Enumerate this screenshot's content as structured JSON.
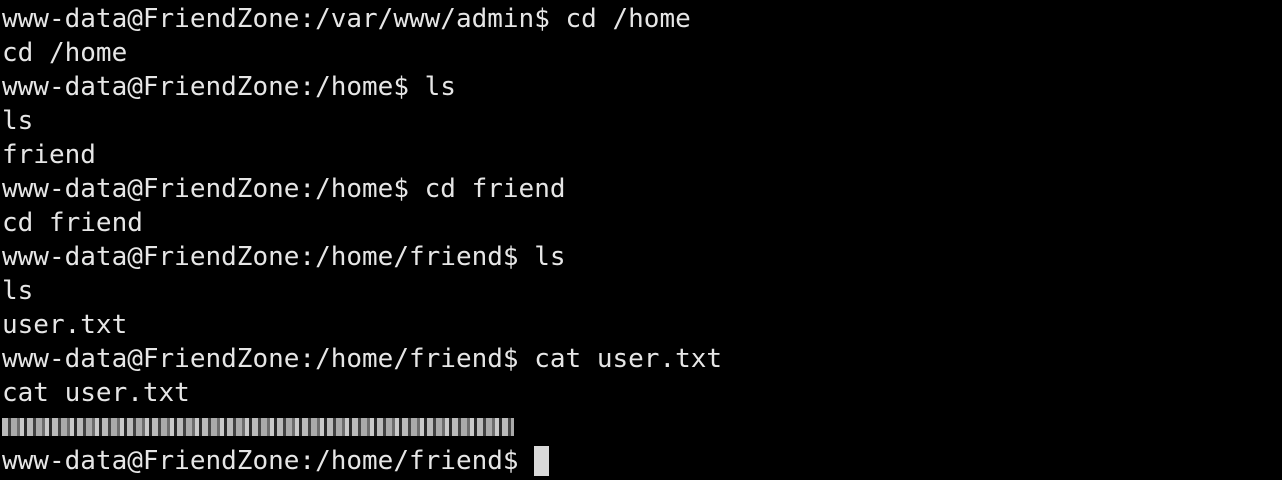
{
  "terminal": {
    "lines": [
      "www-data@FriendZone:/var/www/admin$ cd /home",
      "cd /home",
      "www-data@FriendZone:/home$ ls",
      "ls",
      "friend",
      "www-data@FriendZone:/home$ cd friend",
      "cd friend",
      "www-data@FriendZone:/home/friend$ ls",
      "ls",
      "user.txt",
      "www-data@FriendZone:/home/friend$ cat user.txt",
      "cat user.txt"
    ],
    "prompt": "www-data@FriendZone:/home/friend$ ",
    "colors": {
      "background": "#000000",
      "text": "#e6e6e6"
    }
  }
}
